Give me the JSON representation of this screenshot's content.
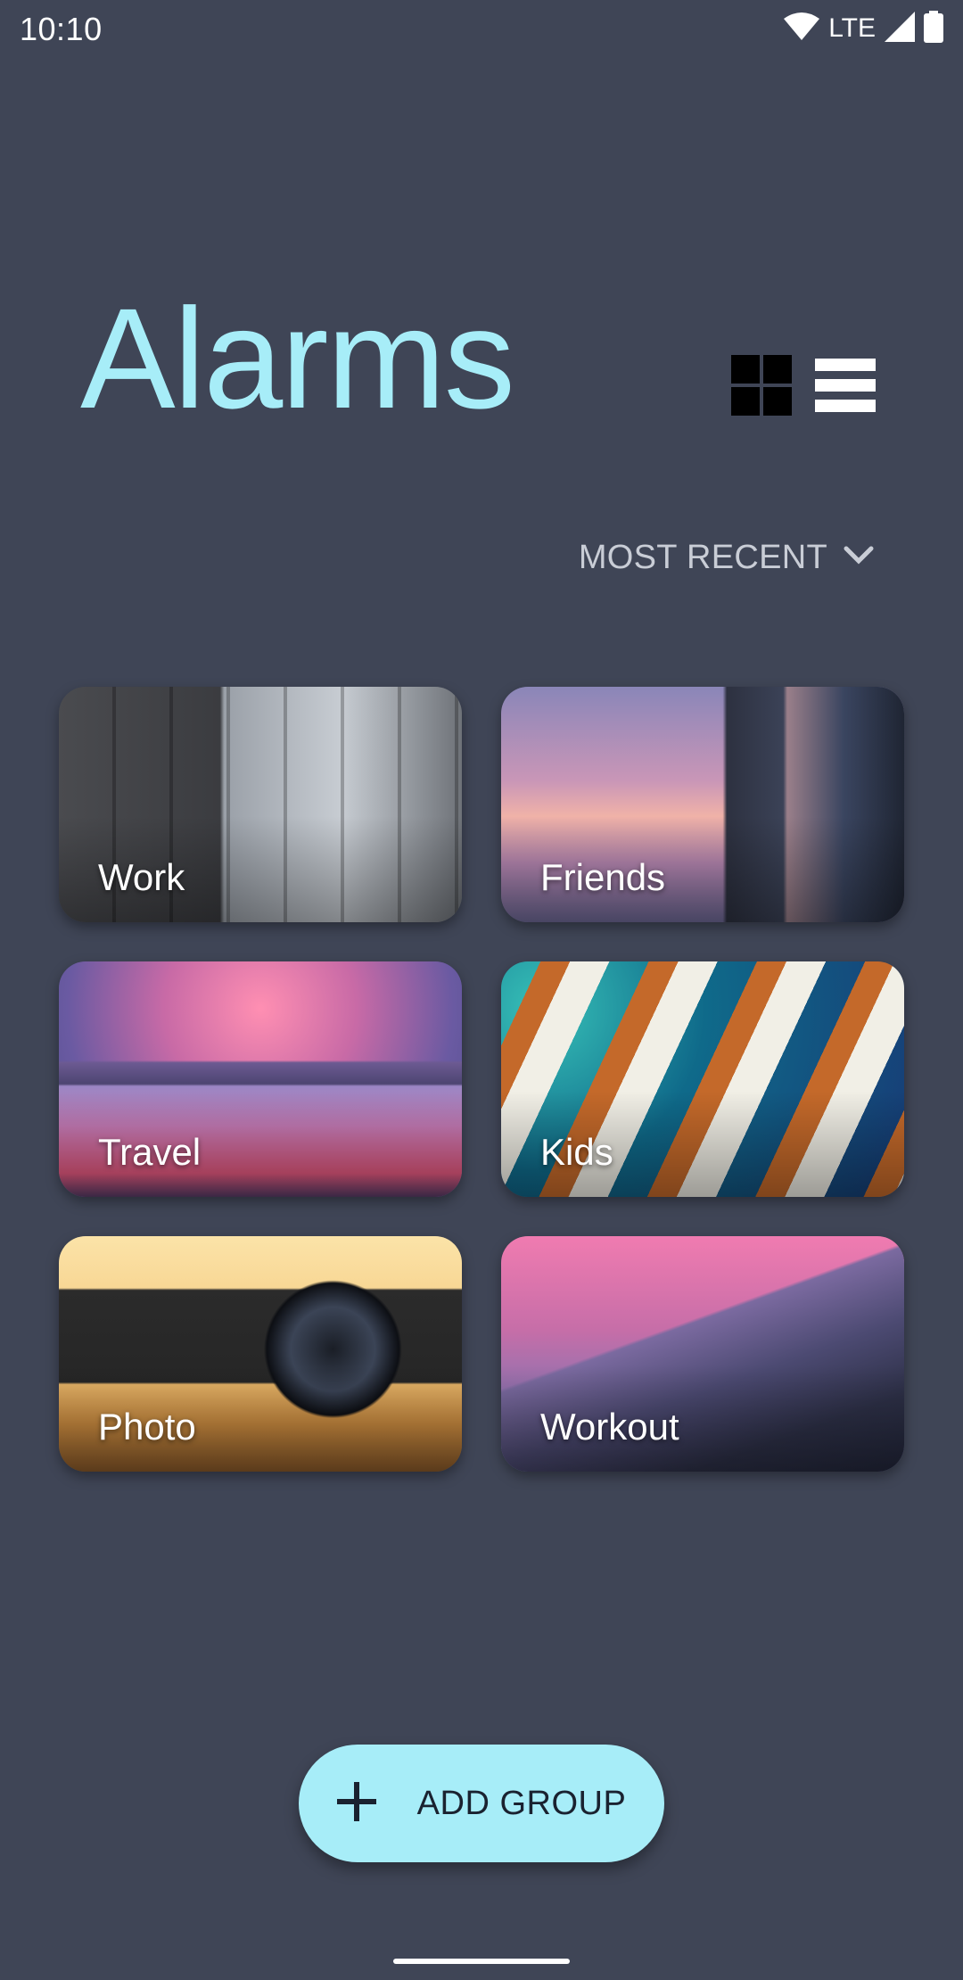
{
  "status_bar": {
    "time": "10:10",
    "network": "LTE",
    "icons": [
      "wifi-icon",
      "signal-icon",
      "battery-icon"
    ]
  },
  "header": {
    "title": "Alarms",
    "view_icons": [
      "grid-view-icon",
      "list-view-icon"
    ]
  },
  "sort": {
    "label": "MOST RECENT",
    "icon": "chevron-down-icon"
  },
  "groups": [
    {
      "label": "Work"
    },
    {
      "label": "Friends"
    },
    {
      "label": "Travel"
    },
    {
      "label": "Kids"
    },
    {
      "label": "Photo"
    },
    {
      "label": "Workout"
    }
  ],
  "fab": {
    "label": "ADD GROUP",
    "icon": "plus-icon"
  },
  "colors": {
    "background": "#3f4556",
    "accent": "#a7edf8"
  }
}
